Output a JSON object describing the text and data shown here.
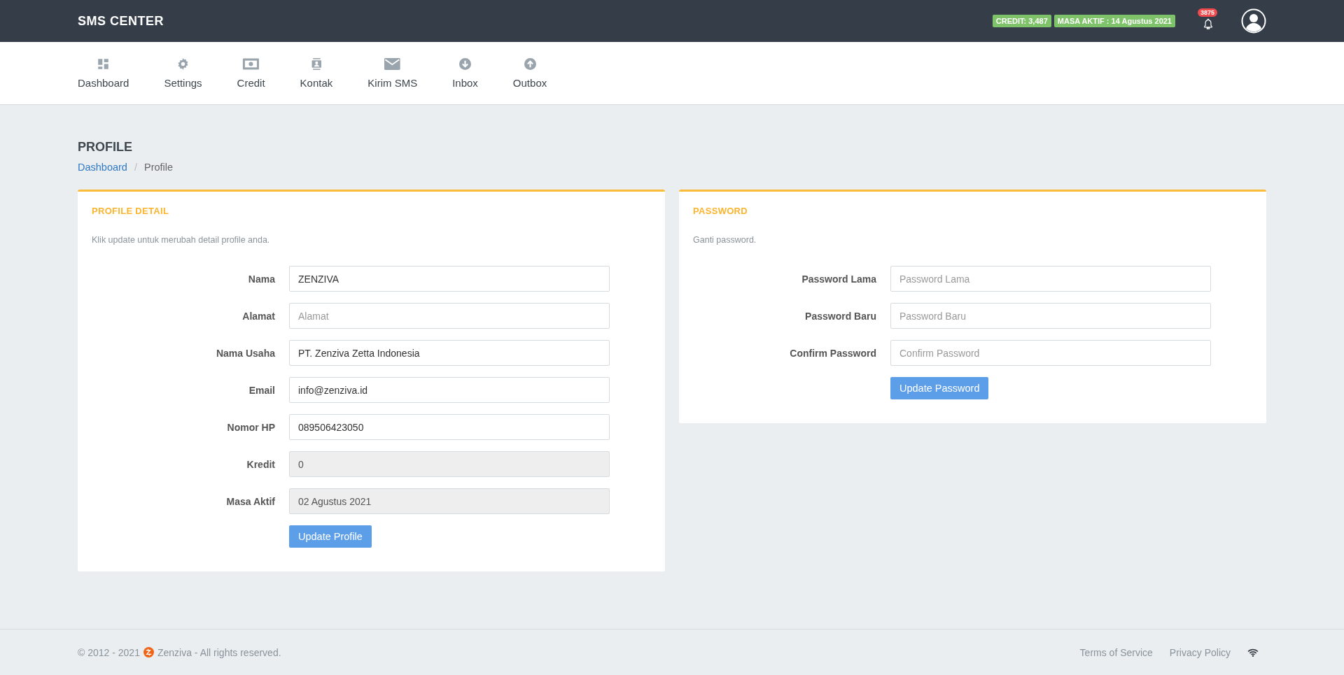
{
  "header": {
    "brand": "SMS CENTER",
    "badges": [
      "CREDIT: 3,487",
      "MASA AKTIF : 14 Agustus 2021"
    ],
    "notification_count": "3875"
  },
  "nav": [
    {
      "label": "Dashboard"
    },
    {
      "label": "Settings"
    },
    {
      "label": "Credit"
    },
    {
      "label": "Kontak"
    },
    {
      "label": "Kirim SMS"
    },
    {
      "label": "Inbox"
    },
    {
      "label": "Outbox"
    }
  ],
  "page_title": "PROFILE",
  "breadcrumb_separator": "/",
  "breadcrumb": [
    {
      "label": "Dashboard",
      "link": true
    },
    {
      "label": "Profile",
      "link": false
    }
  ],
  "cards": [
    {
      "title": "PROFILE DETAIL",
      "description": "Klik update untuk merubah detail profile anda.",
      "fields": [
        {
          "label": "Nama",
          "value": "ZENZIVA",
          "disabled": false
        },
        {
          "label": "Alamat",
          "placeholder": "Alamat",
          "disabled": false
        },
        {
          "label": "Nama Usaha",
          "value": "PT. Zenziva Zetta Indonesia",
          "disabled": false
        },
        {
          "label": "Email",
          "value": "info@zenziva.id",
          "disabled": false
        },
        {
          "label": "Nomor HP",
          "value": "089506423050",
          "disabled": false
        },
        {
          "label": "Kredit",
          "value": "0",
          "disabled": true
        },
        {
          "label": "Masa Aktif",
          "value": "02 Agustus 2021",
          "disabled": true
        }
      ],
      "button": "Update Profile"
    },
    {
      "title": "PASSWORD",
      "description": "Ganti password.",
      "fields": [
        {
          "label": "Password Lama",
          "placeholder": "Password Lama",
          "disabled": false
        },
        {
          "label": "Password Baru",
          "placeholder": "Password Baru",
          "disabled": false
        },
        {
          "label": "Confirm Password",
          "placeholder": "Confirm Password",
          "disabled": false
        }
      ],
      "button": "Update Password"
    }
  ],
  "footer": {
    "copyright": "© 2012 - 2021",
    "company": "Zenziva - All rights reserved.",
    "links": [
      "Terms of Service",
      "Privacy Policy"
    ]
  }
}
